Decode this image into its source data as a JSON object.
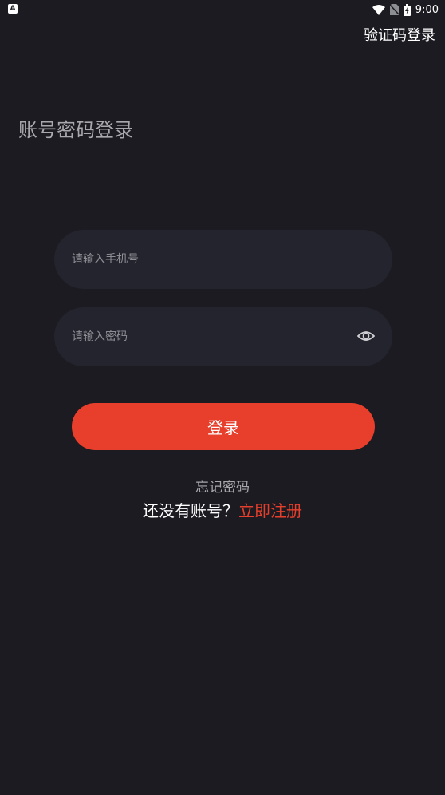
{
  "status_bar": {
    "app_icon_letter": "A",
    "time": "9:00",
    "icons": [
      "wifi-icon",
      "no-sim-icon",
      "battery-charging-icon"
    ]
  },
  "header": {
    "switch_login_label": "验证码登录"
  },
  "page_title": "账号密码登录",
  "form": {
    "phone_placeholder": "请输入手机号",
    "phone_value": "",
    "password_placeholder": "请输入密码",
    "password_value": "",
    "password_toggle_icon": "eye-icon",
    "login_label": "登录"
  },
  "footer": {
    "forgot_label": "忘记密码",
    "no_account_text": "还没有账号？",
    "register_label": "立即注册"
  },
  "colors": {
    "background": "#1c1b21",
    "input_background": "#23242d",
    "accent": "#e73f2b",
    "muted_text": "#a8a8ad"
  }
}
